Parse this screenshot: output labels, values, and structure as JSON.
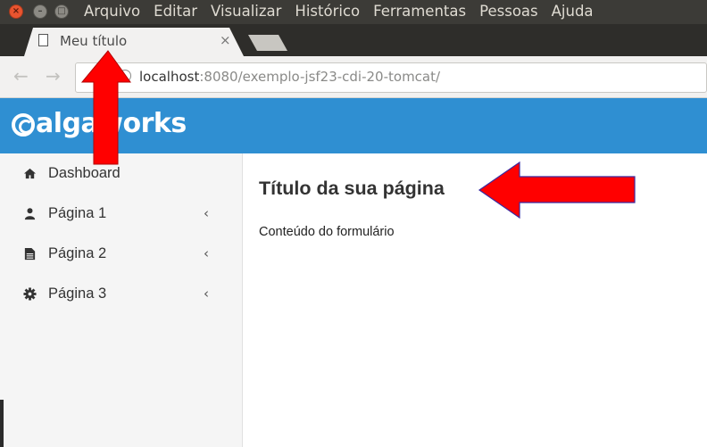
{
  "os_menubar": {
    "items": [
      "Arquivo",
      "Editar",
      "Visualizar",
      "Histórico",
      "Ferramentas",
      "Pessoas",
      "Ajuda"
    ]
  },
  "browser": {
    "tab_title": "Meu título",
    "tab_close": "×",
    "back_glyph": "←",
    "forward_glyph": "→",
    "url_host": "localhost",
    "url_path": ":8080/exemplo-jsf23-cdi-20-tomcat/"
  },
  "app": {
    "brand": "algaworks",
    "brand_color": "#2f8fd2",
    "sidebar": {
      "items": [
        {
          "label": "Dashboard",
          "icon": "home-icon",
          "chevron": ""
        },
        {
          "label": "Página 1",
          "icon": "user-icon",
          "chevron": "‹"
        },
        {
          "label": "Página 2",
          "icon": "file-icon",
          "chevron": "‹"
        },
        {
          "label": "Página 3",
          "icon": "gear-icon",
          "chevron": "‹"
        }
      ]
    },
    "content": {
      "title": "Título da sua página",
      "body": "Conteúdo do formulário"
    }
  },
  "annotations": {
    "arrow_color": "#ff0000"
  }
}
